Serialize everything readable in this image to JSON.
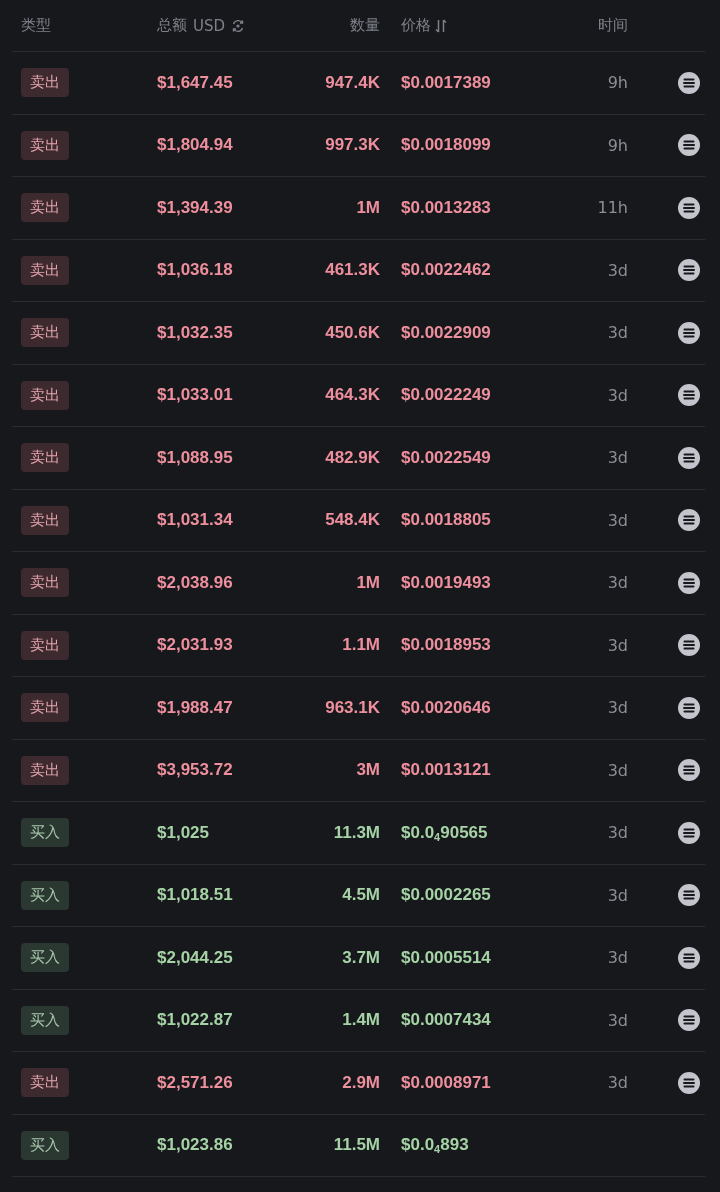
{
  "header": {
    "type": "类型",
    "amount": "总额",
    "currency": "USD",
    "quantity": "数量",
    "price": "价格",
    "time": "时间"
  },
  "rows": [
    {
      "kind": "sell",
      "label": "卖出",
      "amount": "$1,647.45",
      "quantity": "947.4K",
      "price": "$0.0017389",
      "time": "9h"
    },
    {
      "kind": "sell",
      "label": "卖出",
      "amount": "$1,804.94",
      "quantity": "997.3K",
      "price": "$0.0018099",
      "time": "9h"
    },
    {
      "kind": "sell",
      "label": "卖出",
      "amount": "$1,394.39",
      "quantity": "1M",
      "price": "$0.0013283",
      "time": "11h"
    },
    {
      "kind": "sell",
      "label": "卖出",
      "amount": "$1,036.18",
      "quantity": "461.3K",
      "price": "$0.0022462",
      "time": "3d"
    },
    {
      "kind": "sell",
      "label": "卖出",
      "amount": "$1,032.35",
      "quantity": "450.6K",
      "price": "$0.0022909",
      "time": "3d"
    },
    {
      "kind": "sell",
      "label": "卖出",
      "amount": "$1,033.01",
      "quantity": "464.3K",
      "price": "$0.0022249",
      "time": "3d"
    },
    {
      "kind": "sell",
      "label": "卖出",
      "amount": "$1,088.95",
      "quantity": "482.9K",
      "price": "$0.0022549",
      "time": "3d"
    },
    {
      "kind": "sell",
      "label": "卖出",
      "amount": "$1,031.34",
      "quantity": "548.4K",
      "price": "$0.0018805",
      "time": "3d"
    },
    {
      "kind": "sell",
      "label": "卖出",
      "amount": "$2,038.96",
      "quantity": "1M",
      "price": "$0.0019493",
      "time": "3d"
    },
    {
      "kind": "sell",
      "label": "卖出",
      "amount": "$2,031.93",
      "quantity": "1.1M",
      "price": "$0.0018953",
      "time": "3d"
    },
    {
      "kind": "sell",
      "label": "卖出",
      "amount": "$1,988.47",
      "quantity": "963.1K",
      "price": "$0.0020646",
      "time": "3d"
    },
    {
      "kind": "sell",
      "label": "卖出",
      "amount": "$3,953.72",
      "quantity": "3M",
      "price": "$0.0013121",
      "time": "3d"
    },
    {
      "kind": "buy",
      "label": "买入",
      "amount": "$1,025",
      "quantity": "11.3M",
      "price": "$0.0$_{4}$90565",
      "time": "3d"
    },
    {
      "kind": "buy",
      "label": "买入",
      "amount": "$1,018.51",
      "quantity": "4.5M",
      "price": "$0.0002265",
      "time": "3d"
    },
    {
      "kind": "buy",
      "label": "买入",
      "amount": "$2,044.25",
      "quantity": "3.7M",
      "price": "$0.0005514",
      "time": "3d"
    },
    {
      "kind": "buy",
      "label": "买入",
      "amount": "$1,022.87",
      "quantity": "1.4M",
      "price": "$0.0007434",
      "time": "3d"
    },
    {
      "kind": "sell",
      "label": "卖出",
      "amount": "$2,571.26",
      "quantity": "2.9M",
      "price": "$0.0008971",
      "time": "3d"
    },
    {
      "kind": "buy",
      "label": "买入",
      "amount": "$1,023.86",
      "quantity": "11.5M",
      "price": "$0.0$_{4}$893"
    }
  ]
}
